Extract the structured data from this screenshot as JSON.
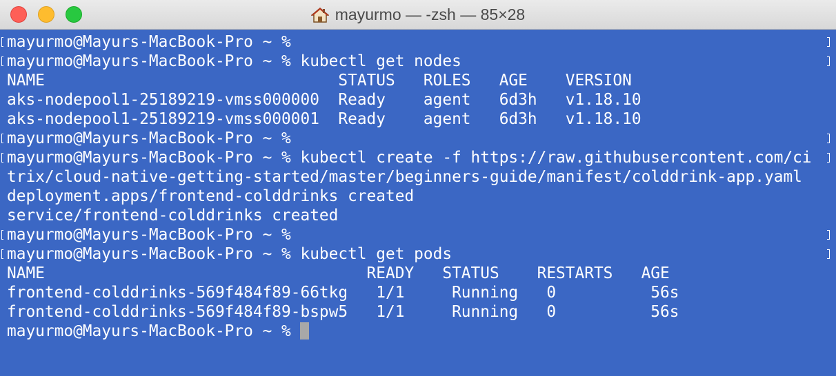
{
  "window": {
    "title": "mayurmo — -zsh — 85×28"
  },
  "icons": {
    "title": "home-icon"
  },
  "colors": {
    "terminal_background": "#3b67c4",
    "terminal_text": "#ffffff",
    "close": "#fe5f57",
    "minimize": "#febc2e",
    "zoom": "#28c840",
    "cursor": "#a8a8a8"
  },
  "terminal": {
    "lines": [
      "mayurmo@Mayurs-MacBook-Pro ~ %",
      "mayurmo@Mayurs-MacBook-Pro ~ % kubectl get nodes",
      "NAME                               STATUS   ROLES   AGE    VERSION",
      "aks-nodepool1-25189219-vmss000000  Ready    agent   6d3h   v1.18.10",
      "aks-nodepool1-25189219-vmss000001  Ready    agent   6d3h   v1.18.10",
      "mayurmo@Mayurs-MacBook-Pro ~ %",
      "mayurmo@Mayurs-MacBook-Pro ~ % kubectl create -f https://raw.githubusercontent.com/ci",
      "trix/cloud-native-getting-started/master/beginners-guide/manifest/colddrink-app.yaml",
      "deployment.apps/frontend-colddrinks created",
      "service/frontend-colddrinks created",
      "mayurmo@Mayurs-MacBook-Pro ~ %",
      "mayurmo@Mayurs-MacBook-Pro ~ % kubectl get pods",
      "NAME                                  READY   STATUS    RESTARTS   AGE",
      "frontend-colddrinks-569f484f89-66tkg   1/1     Running   0          56s",
      "frontend-colddrinks-569f484f89-bspw5   1/1     Running   0          56s",
      "mayurmo@Mayurs-MacBook-Pro ~ % "
    ]
  }
}
